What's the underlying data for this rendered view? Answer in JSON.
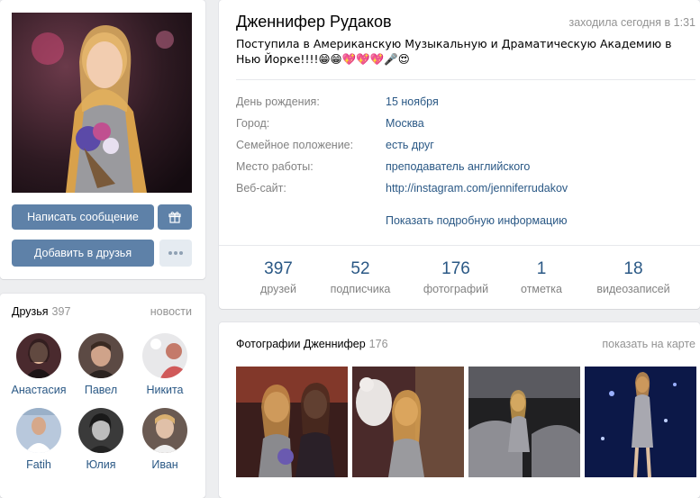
{
  "profile": {
    "name": "Дженнифер Рудаков",
    "online": "заходила сегодня в 1:31",
    "status": "Поступила в Американскую Музыкальную и Драматическую Академию в Нью Йорке!!!!😁😁💖💖💖🎤😍",
    "info": [
      {
        "label": "День рождения:",
        "value": "15 ноября"
      },
      {
        "label": "Город:",
        "value": "Москва"
      },
      {
        "label": "Семейное положение:",
        "value": "есть друг"
      },
      {
        "label": "Место работы:",
        "value": "преподаватель английского"
      },
      {
        "label": "Веб-сайт:",
        "value": "http://instagram.com/jenniferrudakov"
      }
    ],
    "show_more": "Показать подробную информацию",
    "counters": [
      {
        "num": "397",
        "label": "друзей"
      },
      {
        "num": "52",
        "label": "подписчика"
      },
      {
        "num": "176",
        "label": "фотографий"
      },
      {
        "num": "1",
        "label": "отметка"
      },
      {
        "num": "18",
        "label": "видеозаписей"
      }
    ]
  },
  "actions": {
    "message": "Написать сообщение",
    "gift_icon": "gift-icon",
    "add_friend": "Добавить в друзья",
    "more_icon": "more-icon"
  },
  "friends": {
    "title": "Друзья",
    "count": "397",
    "news_link": "новости",
    "items": [
      {
        "name": "Анастасия"
      },
      {
        "name": "Павел"
      },
      {
        "name": "Никита"
      },
      {
        "name": "Fatih"
      },
      {
        "name": "Юлия"
      },
      {
        "name": "Иван"
      }
    ]
  },
  "photos": {
    "title": "Фотографии Дженнифер",
    "count": "176",
    "map_link": "показать на карте"
  },
  "colors": {
    "link": "#2a5885",
    "button": "#5e81a8",
    "muted": "#828282",
    "background": "#edeef0"
  }
}
